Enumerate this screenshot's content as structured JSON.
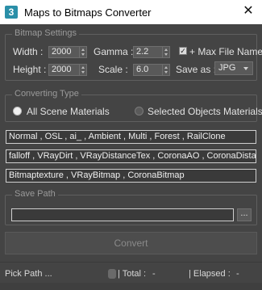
{
  "window": {
    "title": "Maps to Bitmaps Converter",
    "icon_glyph": "3",
    "close_glyph": "✕"
  },
  "bitmap_settings": {
    "group_label": "Bitmap Settings",
    "width_label": "Width :",
    "width_value": "2000",
    "height_label": "Height :",
    "height_value": "2000",
    "gamma_label": "Gamma :",
    "gamma_value": "2.2",
    "scale_label": "Scale :",
    "scale_value": "6.0",
    "max_file_name_label": "+ Max File Name",
    "max_file_name_checked": true,
    "save_as_label": "Save as :",
    "save_as_value": "JPG"
  },
  "converting_type": {
    "group_label": "Converting Type",
    "option_all": "All Scene Materials",
    "option_selected": "Selected Objects Materials",
    "selected_option": "all"
  },
  "filters": {
    "row1": "Normal , OSL , ai_ , Ambient , Multi , Forest , RailClone",
    "row2": "falloff , VRayDirt , VRayDistanceTex , CoronaAO , CoronaDista",
    "row3": "Bitmaptexture , VRayBitmap , CoronaBitmap"
  },
  "save_path": {
    "group_label": "Save Path",
    "value": "",
    "browse_label": "..."
  },
  "convert_button": {
    "label": "Convert",
    "enabled": false
  },
  "status": {
    "pick_path_label": "Pick Path ...",
    "total_label": "| Total :",
    "total_value": "-",
    "elapsed_label": "| Elapsed :",
    "elapsed_value": "-"
  }
}
